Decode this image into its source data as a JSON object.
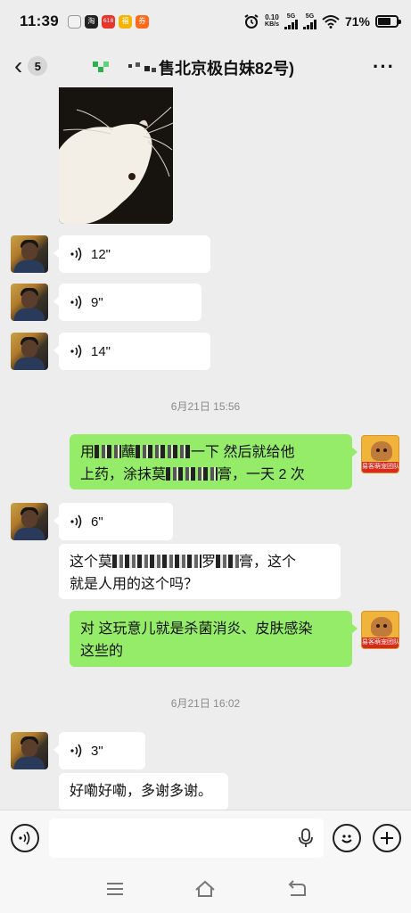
{
  "status_bar": {
    "time": "11:39",
    "app_icons": [
      {
        "name": "clock-app-icon",
        "label": "",
        "color": "#f2f2f2"
      },
      {
        "name": "taobao-app-icon",
        "label": "淘",
        "color": "#222222"
      },
      {
        "name": "red-app-icon",
        "label": "618",
        "color": "#e8352b"
      },
      {
        "name": "yellow-app-icon",
        "label": "福",
        "color": "#f5b400"
      },
      {
        "name": "coupon-app-icon",
        "label": "券",
        "color": "#ff6a1a"
      }
    ],
    "net_speed_value": "0.10",
    "net_speed_unit": "KB/s",
    "signal_label_1": "5G",
    "signal_label_2": "5G",
    "battery": "71%",
    "battery_level": 0.71
  },
  "header": {
    "unread_count": "5",
    "title": "售北京极白妹82号)"
  },
  "messages": [
    {
      "id": "v1",
      "type": "voice",
      "duration": "12\""
    },
    {
      "id": "v2",
      "type": "voice",
      "duration": "9\""
    },
    {
      "id": "v3",
      "type": "voice",
      "duration": "14\""
    },
    {
      "id": "t1",
      "type": "time",
      "text": "6月21日 15:56"
    },
    {
      "id": "m1",
      "type": "text",
      "from": "self",
      "line1_a": "用",
      "line1_b": "蘸",
      "line1_c": "一下 然后就给他",
      "line2_a": "上药，涂抹莫",
      "line2_b": "膏，一天 2 次"
    },
    {
      "id": "v4",
      "type": "voice",
      "duration": "6\""
    },
    {
      "id": "m2",
      "type": "text",
      "from": "other",
      "line1_a": "这个莫",
      "line1_b": "罗",
      "line1_c": "膏，这个",
      "line2": "就是人用的这个吗？"
    },
    {
      "id": "m3",
      "type": "text",
      "from": "self",
      "line1": "对 这玩意儿就是杀菌消炎、皮肤感染",
      "line2": "这些的"
    },
    {
      "id": "t2",
      "type": "time",
      "text": "6月21日 16:02"
    },
    {
      "id": "v5",
      "type": "voice",
      "duration": "3\""
    },
    {
      "id": "m4",
      "type": "text",
      "from": "other",
      "text": "好嘞好嘞，多谢多谢。"
    }
  ],
  "self_avatar_banner": "易客萌宠团队",
  "input": {
    "value": "",
    "placeholder": ""
  },
  "colors": {
    "self_bubble": "#95ec69",
    "other_bubble": "#ffffff",
    "background": "#ededed"
  }
}
